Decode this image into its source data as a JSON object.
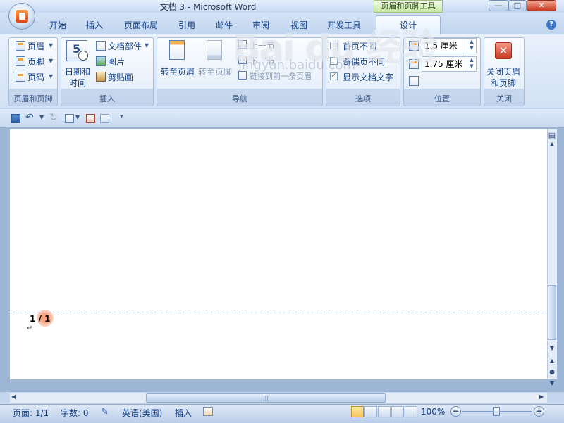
{
  "window": {
    "title": "文档 3 - Microsoft Word",
    "context_tab_group": "页眉和页脚工具",
    "minimize": "—",
    "maximize": "□",
    "close": "✕"
  },
  "tabs": [
    "开始",
    "插入",
    "页面布局",
    "引用",
    "邮件",
    "审阅",
    "视图",
    "开发工具",
    "设计"
  ],
  "help": "?",
  "ribbon": {
    "group_header_footer": {
      "label": "页眉和页脚",
      "header": "页眉",
      "footer": "页脚",
      "page_number": "页码"
    },
    "group_insert": {
      "label": "插入",
      "date_time_line1": "日期和",
      "date_time_line2": "时间",
      "calendar_number": "5",
      "quick_parts": "文档部件",
      "picture": "图片",
      "clip_art": "剪贴画"
    },
    "group_navigation": {
      "label": "导航",
      "goto_header": "转至页眉",
      "goto_footer": "转至页脚",
      "previous": "上一节",
      "next": "下一节",
      "link_previous": "链接到前一条页眉"
    },
    "group_options": {
      "label": "选项",
      "different_first": "首页不同",
      "different_odd_even": "奇偶页不同",
      "show_document_text": "显示文档文字"
    },
    "group_position": {
      "label": "位置",
      "header_from_top": "1.5 厘米",
      "footer_from_bottom": "1.75 厘米"
    },
    "group_close": {
      "label": "关闭",
      "close_line1": "关闭页眉",
      "close_line2": "和页脚"
    }
  },
  "document": {
    "page_number_text": "1 / 1",
    "paragraph_mark": "↵"
  },
  "statusbar": {
    "page": "页面: 1/1",
    "word_count": "字数: 0",
    "language": "英语(美国)",
    "insert_mode": "插入",
    "zoom": "100%",
    "zoom_out": "−",
    "zoom_in": "+"
  },
  "watermark": {
    "brand": "Bai du 经验",
    "url": "jingyan.baidu.com"
  }
}
